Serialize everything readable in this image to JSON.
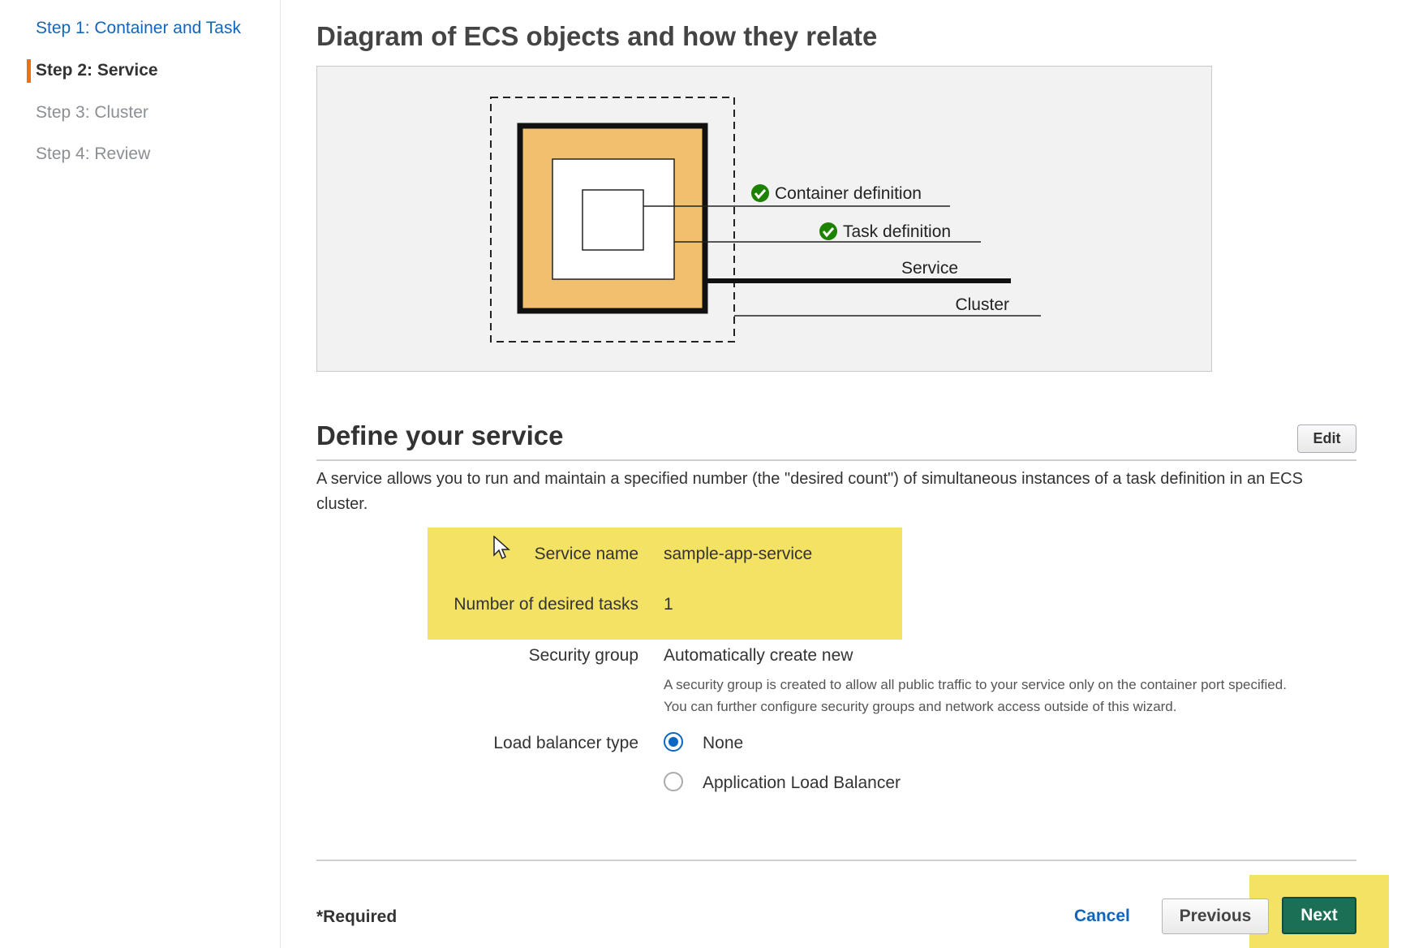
{
  "sidebar": {
    "steps": [
      {
        "label": "Step 1: Container and Task",
        "state": "done"
      },
      {
        "label": "Step 2: Service",
        "state": "active"
      },
      {
        "label": "Step 3: Cluster",
        "state": "todo"
      },
      {
        "label": "Step 4: Review",
        "state": "todo"
      }
    ]
  },
  "diagram": {
    "title": "Diagram of ECS objects and how they relate",
    "labels": {
      "container": "Container definition",
      "task": "Task definition",
      "service": "Service",
      "cluster": "Cluster"
    }
  },
  "service_section": {
    "title": "Define your service",
    "edit_label": "Edit",
    "description": "A service allows you to run and maintain a specified number (the \"desired count\") of simultaneous instances of a task definition in an ECS cluster.",
    "fields": {
      "service_name": {
        "label": "Service name",
        "value": "sample-app-service"
      },
      "desired_tasks": {
        "label": "Number of desired tasks",
        "value": "1"
      },
      "security_group": {
        "label": "Security group",
        "value": "Automatically create new",
        "help_line1": "A security group is created to allow all public traffic to your service only on the container port specified.",
        "help_line2": "You can further configure security groups and network access outside of this wizard."
      },
      "load_balancer": {
        "label": "Load balancer type",
        "options": [
          "None",
          "Application Load Balancer"
        ],
        "selected": "None"
      }
    }
  },
  "footer": {
    "required": "*Required",
    "cancel": "Cancel",
    "previous": "Previous",
    "next": "Next"
  },
  "colors": {
    "highlight": "#f4e264",
    "accent_orange": "#ec7211",
    "link_blue": "#1166bb",
    "next_green": "#1a6f55",
    "check_green": "#1d8102"
  }
}
